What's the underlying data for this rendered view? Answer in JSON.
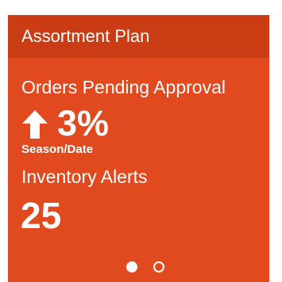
{
  "tile": {
    "title": "Assortment Plan",
    "accent_color": "#e04a1e",
    "header_color": "#c93c14"
  },
  "metric_orders": {
    "label": "Orders Pending Approval",
    "trend_icon": "up-arrow-icon",
    "value": "3%",
    "sublabel": "Season/Date"
  },
  "metric_inventory": {
    "label": "Inventory Alerts",
    "value": "25"
  },
  "pager": {
    "page_count": 2,
    "active_page": 1
  }
}
